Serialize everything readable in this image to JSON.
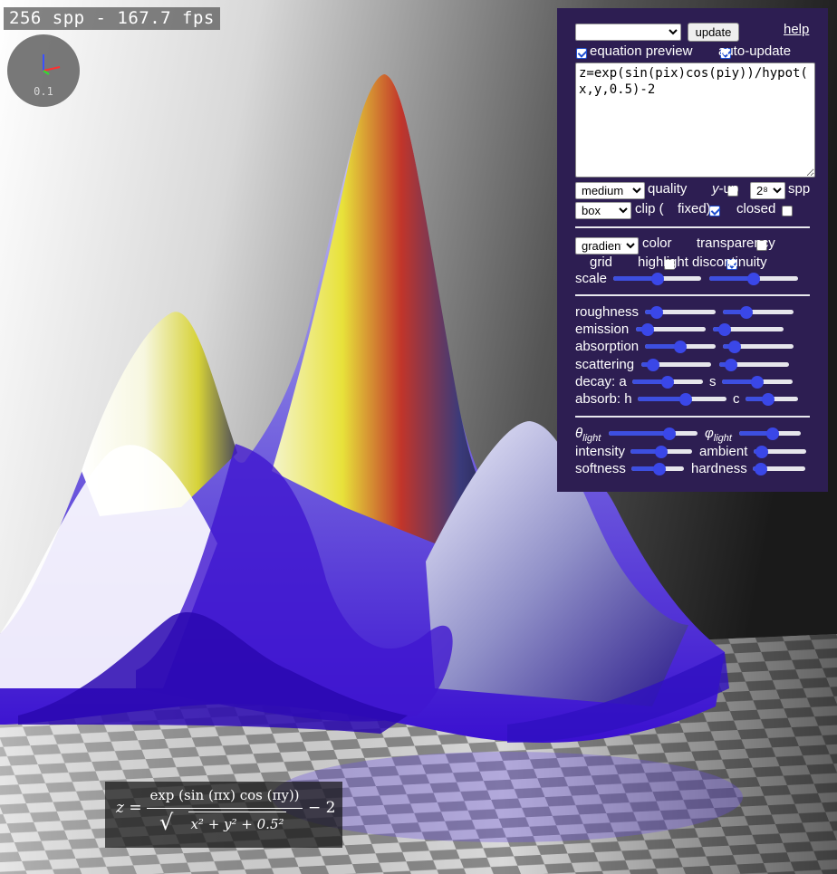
{
  "stats": {
    "text": "256 spp - 167.7 fps"
  },
  "axes_widget": {
    "scale": "0.1"
  },
  "equation_preview": {
    "lhs": "z =",
    "numerator": "exp (sin (πx) cos (πy))",
    "denominator": "x² + y² + 0.5²",
    "rhs": "− 2"
  },
  "panel": {
    "preset_select": {
      "value": ""
    },
    "update_button": "update",
    "help_link": "help",
    "equation_preview_label": "equation preview",
    "equation_preview_checked": true,
    "auto_update_label": "auto-update",
    "auto_update_checked": true,
    "equation_text": "z=exp(sin(pix)cos(piy))/hypot(x,y,0.5)-2",
    "quality": {
      "value": "medium",
      "label": "quality"
    },
    "y_up": {
      "label_italic": "y",
      "label_rest": "-up",
      "checked": false
    },
    "spp": {
      "value": "2⁸",
      "label": "spp"
    },
    "clip": {
      "value": "box",
      "label": "clip ("
    },
    "fixed": {
      "label": "fixed)",
      "checked": true
    },
    "closed": {
      "label": "closed",
      "checked": false
    },
    "color": {
      "value": "gradient",
      "label": "color"
    },
    "transparency": {
      "label": "transparency",
      "checked": false
    },
    "grid": {
      "label": "grid",
      "checked": false
    },
    "highlight_discontinuity": {
      "label": "highlight discontinuity",
      "checked": true
    },
    "scale_label": "scale",
    "roughness_label": "roughness",
    "emission_label": "emission",
    "absorption_label": "absorption",
    "scattering_label": "scattering",
    "decay_label": "decay: a",
    "decay_s_label": "s",
    "absorb_label": "absorb: h",
    "absorb_c_label": "c",
    "theta_light": {
      "symbol": "θ",
      "sub": "light"
    },
    "phi_light": {
      "symbol": "φ",
      "sub": "light"
    },
    "intensity_label": "intensity",
    "ambient_label": "ambient",
    "softness_label": "softness",
    "hardness_label": "hardness",
    "sliders": {
      "scale_1": 0.5,
      "scale_2": 0.5,
      "roughness_1": 0.1,
      "roughness_2": 0.3,
      "emission_1": 0.1,
      "emission_2": 0.1,
      "absorption_1": 0.5,
      "absorption_2": 0.1,
      "scattering_1": 0.1,
      "scattering_2": 0.1,
      "decay_a": 0.5,
      "decay_s": 0.5,
      "absorb_h": 0.55,
      "absorb_c": 0.4,
      "theta_light": 0.72,
      "phi_light": 0.55,
      "intensity": 0.5,
      "ambient": 0.05,
      "softness": 0.55,
      "hardness": 0.05
    }
  },
  "colors": {
    "panel_bg": "#2d1e52",
    "slider_accent": "#3d4fe0",
    "surface_purple": "#3a10d0",
    "surface_yellow": "#e8e23a"
  }
}
